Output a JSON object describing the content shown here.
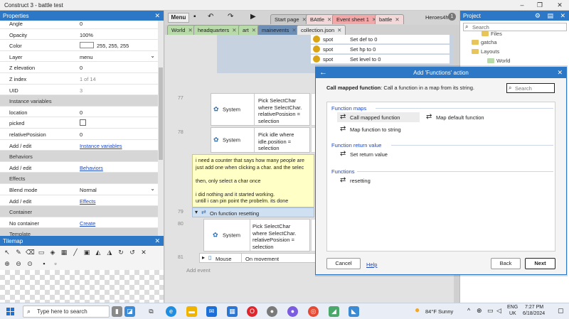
{
  "window": {
    "title": "Construct 3 - battle test"
  },
  "properties": {
    "title": "Properties",
    "rows": [
      {
        "key": "Angle",
        "value": "0",
        "type": "text"
      },
      {
        "key": "Opacity",
        "value": "100%",
        "type": "text"
      },
      {
        "key": "Color",
        "value": "255, 255, 255",
        "type": "color"
      },
      {
        "key": "Layer",
        "value": "menu",
        "type": "dropdown"
      },
      {
        "key": "Z elevation",
        "value": "0",
        "type": "text"
      },
      {
        "key": "Z index",
        "value": "1 of 14",
        "type": "grey"
      },
      {
        "key": "UID",
        "value": "3",
        "type": "grey"
      },
      {
        "key": "Instance variables",
        "value": "",
        "type": "section"
      },
      {
        "key": "location",
        "value": "0",
        "type": "text"
      },
      {
        "key": "picked",
        "value": "",
        "type": "checkbox"
      },
      {
        "key": "relativePosision",
        "value": "0",
        "type": "text"
      },
      {
        "key": "Add / edit",
        "value": "Instance variables",
        "type": "link"
      },
      {
        "key": "Behaviors",
        "value": "",
        "type": "section"
      },
      {
        "key": "Add / edit",
        "value": "Behaviors",
        "type": "link"
      },
      {
        "key": "Effects",
        "value": "",
        "type": "section"
      },
      {
        "key": "Blend mode",
        "value": "Normal",
        "type": "dropdown"
      },
      {
        "key": "Add / edit",
        "value": "Effects",
        "type": "link"
      },
      {
        "key": "Container",
        "value": "",
        "type": "section"
      },
      {
        "key": "No container",
        "value": "Create",
        "type": "link"
      },
      {
        "key": "Template",
        "value": "",
        "type": "section"
      }
    ]
  },
  "tilemap": {
    "title": "Tilemap"
  },
  "toolbar": {
    "menu_label": "Menu"
  },
  "tabs_top": [
    {
      "label": "Start page",
      "color": "#c9c9c9"
    },
    {
      "label": "BAttle",
      "color": "#f2d8d8"
    },
    {
      "label": "Event sheet 1",
      "color": "#f2a8a8"
    },
    {
      "label": "battle",
      "color": "#f2d8d8"
    }
  ],
  "tabs_sub": [
    {
      "label": "World",
      "color": "#b8d9a8"
    },
    {
      "label": "headquarters",
      "color": "#b8d9a8"
    },
    {
      "label": "art",
      "color": "#b8d9a8"
    },
    {
      "label": "mainevents",
      "color": "#6e8fb5"
    },
    {
      "label": "collection.json",
      "color": "#e8e8e8"
    }
  ],
  "user": {
    "name": "Heroes4hire",
    "badge": "1"
  },
  "events": {
    "actions": [
      {
        "obj": "spot",
        "text": "Set def to 0"
      },
      {
        "obj": "spot",
        "text": "Set hp to 0"
      },
      {
        "obj": "spot",
        "text": "Set level to 0"
      }
    ],
    "line77": "77",
    "line78": "78",
    "line79": "79",
    "line80": "80",
    "line81": "81",
    "cond1": {
      "obj": "System",
      "text": "Pick  SelectChar where SelectChar. relativePosision = selection"
    },
    "cond2": {
      "obj": "System",
      "text": "Pick      idle where idle.position = selection"
    },
    "comment": [
      "i need a counter that says how many people are",
      "just add one when clicking a char.  and the selec",
      "",
      "then,    only select a char once",
      "",
      "i did nothing and it started working.",
      "untill i can pin point the probelm. its done"
    ],
    "function_row": "On function resetting",
    "cond3": {
      "obj": "System",
      "text": "Pick  SelectChar where SelectChar. relativePosision = selection"
    },
    "mouse": {
      "obj": "Mouse",
      "text": "On movement"
    },
    "add_event": "Add event"
  },
  "project": {
    "title": "Project",
    "search_placeholder": "Search",
    "items": [
      "Files",
      "gatcha",
      "Layouts",
      "World"
    ]
  },
  "dialog": {
    "title": "Add 'Functions' action",
    "desc_bold": "Call mapped function",
    "desc_rest": ": Call a function in a map from its string.",
    "search_placeholder": "Search",
    "groups": [
      {
        "label": "Function maps",
        "items": [
          "Call mapped function",
          "Map function to string",
          "Map default function"
        ]
      },
      {
        "label": "Function return value",
        "items": [
          "Set return value"
        ]
      },
      {
        "label": "Functions",
        "items": [
          "resetting"
        ]
      }
    ],
    "cancel": "Cancel",
    "help": "Help",
    "back": "Back",
    "next": "Next"
  },
  "taskbar": {
    "search_placeholder": "Type here to search",
    "weather": "84°F  Sunny",
    "lang1": "ENG",
    "lang2": "UK",
    "time": "7:27 PM",
    "date": "6/18/2024"
  }
}
